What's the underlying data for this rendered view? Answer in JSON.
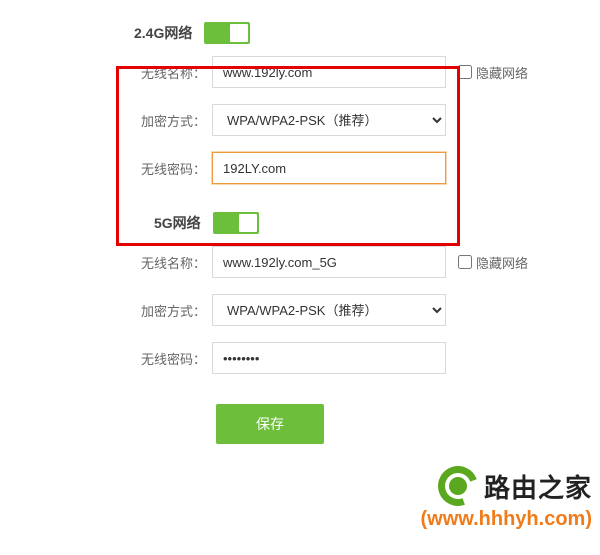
{
  "section24": {
    "title": "2.4G网络",
    "toggle_on": true,
    "ssid_label": "无线名称：",
    "ssid_value": "www.192ly.com",
    "hide_label": "隐藏网络",
    "enc_label": "加密方式：",
    "enc_selected": "WPA/WPA2-PSK（推荐）",
    "pwd_label": "无线密码：",
    "pwd_value": "192LY.com"
  },
  "section5g": {
    "title": "5G网络",
    "toggle_on": true,
    "ssid_label": "无线名称：",
    "ssid_value": "www.192ly.com_5G",
    "hide_label": "隐藏网络",
    "enc_label": "加密方式：",
    "enc_selected": "WPA/WPA2-PSK（推荐）",
    "pwd_label": "无线密码：",
    "pwd_value": "••••••••"
  },
  "save_label": "保存",
  "brand_name": "路由之家",
  "brand_url": "(www.hhhyh.com)"
}
